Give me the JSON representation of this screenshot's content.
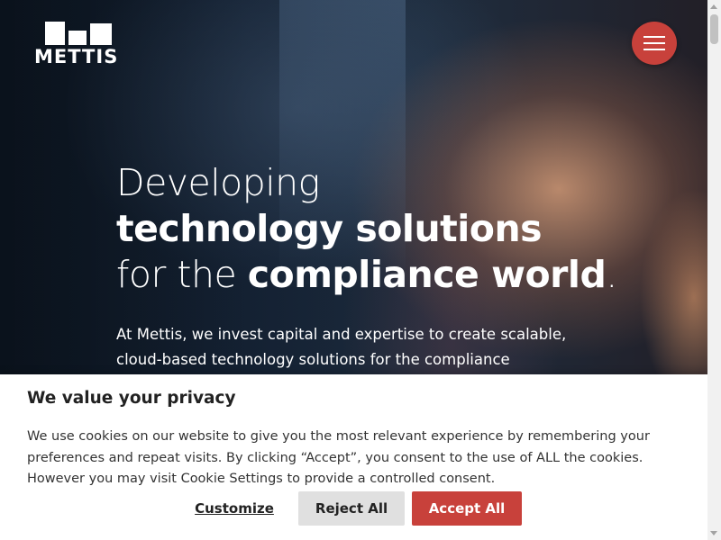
{
  "brand": {
    "name": "METTIS",
    "accent": "#c8413b"
  },
  "header": {
    "menu_icon": "hamburger-icon"
  },
  "hero": {
    "line1": "Developing",
    "line2": "technology solutions",
    "line3_prefix": "for the ",
    "line3_bold": "compliance world",
    "line3_suffix": ".",
    "intro": "At Mettis, we invest capital and expertise to create scalable, cloud-based technology solutions for the compliance"
  },
  "cookie_banner": {
    "title": "We value your privacy",
    "body": "We use cookies on our website to give you the most relevant experience by remembering your preferences and repeat visits. By clicking “Accept”, you consent to the use of ALL the cookies. However you may visit Cookie Settings to provide a controlled consent.",
    "customize_label": "Customize",
    "reject_label": "Reject All",
    "accept_label": "Accept All"
  }
}
